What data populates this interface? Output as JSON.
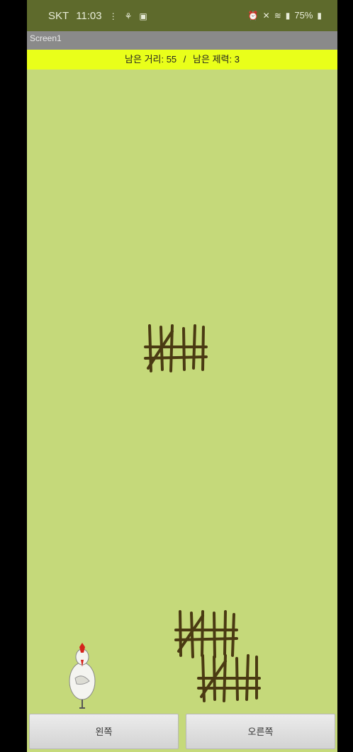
{
  "status_bar": {
    "carrier": "SKT",
    "time": "11:03",
    "battery": "75%"
  },
  "title_bar": {
    "title": "Screen1"
  },
  "info": {
    "distance_label": "남은 거리: 55",
    "separator": "/",
    "obstacle_label": "남은 제력: 3"
  },
  "controls": {
    "left_label": "왼쪽",
    "right_label": "오른쪽"
  },
  "colors": {
    "background": "#c5d97a",
    "status_bar": "#5e6a2c",
    "info_bar": "#e9ff1a",
    "fence": "#4a3a12"
  }
}
